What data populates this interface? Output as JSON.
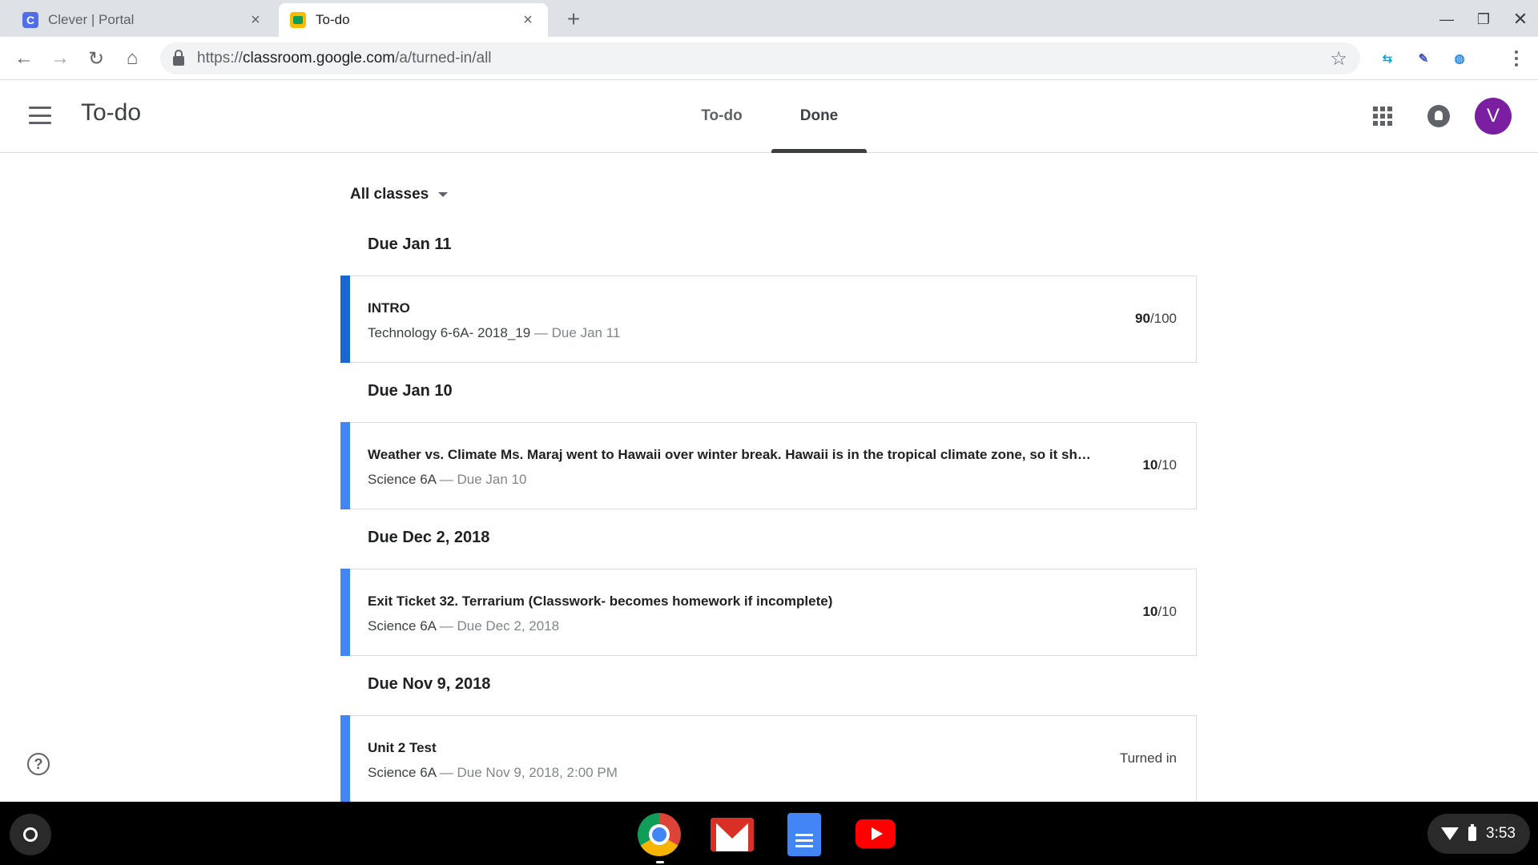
{
  "browser": {
    "tabs": [
      {
        "title": "Clever | Portal",
        "favicon": "C",
        "active": false
      },
      {
        "title": "To-do",
        "favicon": "classroom-icon",
        "active": true
      }
    ],
    "url": {
      "scheme": "https://",
      "host": "classroom.google.com",
      "path": "/a/turned-in/all"
    }
  },
  "header": {
    "title": "To-do",
    "tabs": [
      {
        "label": "To-do",
        "active": false
      },
      {
        "label": "Done",
        "active": true
      }
    ],
    "avatar_initial": "V"
  },
  "filter": {
    "label": "All classes"
  },
  "groups": [
    {
      "heading": "Due Jan 11",
      "items": [
        {
          "title": "INTRO",
          "class": "Technology 6-6A- 2018_19",
          "due": "Due Jan 11",
          "grade_value": "90",
          "grade_total": "/100",
          "status": ""
        }
      ]
    },
    {
      "heading": "Due Jan 10",
      "items": [
        {
          "title": "Weather vs. Climate Ms. Maraj went to Hawaii over winter break. Hawaii is in the tropical climate zone, so it sho...",
          "class": "Science 6A",
          "due": "Due Jan 10",
          "grade_value": "10",
          "grade_total": "/10",
          "status": ""
        }
      ]
    },
    {
      "heading": "Due Dec 2, 2018",
      "items": [
        {
          "title": "Exit Ticket 32. Terrarium (Classwork- becomes homework if incomplete)",
          "class": "Science 6A",
          "due": "Due Dec 2, 2018",
          "grade_value": "10",
          "grade_total": "/10",
          "status": ""
        }
      ]
    },
    {
      "heading": "Due Nov 9, 2018",
      "items": [
        {
          "title": "Unit 2 Test",
          "class": "Science 6A",
          "due": "Due Nov 9, 2018, 2:00 PM",
          "grade_value": "",
          "grade_total": "",
          "status": "Turned in"
        }
      ]
    }
  ],
  "separator": " — ",
  "shelf": {
    "apps": [
      "chrome-icon",
      "gmail-icon",
      "docs-icon",
      "youtube-icon"
    ],
    "time": "3:53"
  },
  "colors": {
    "stripe_primary": "#1967d2",
    "stripe": "#4285f4",
    "avatar": "#7b1fa2"
  }
}
